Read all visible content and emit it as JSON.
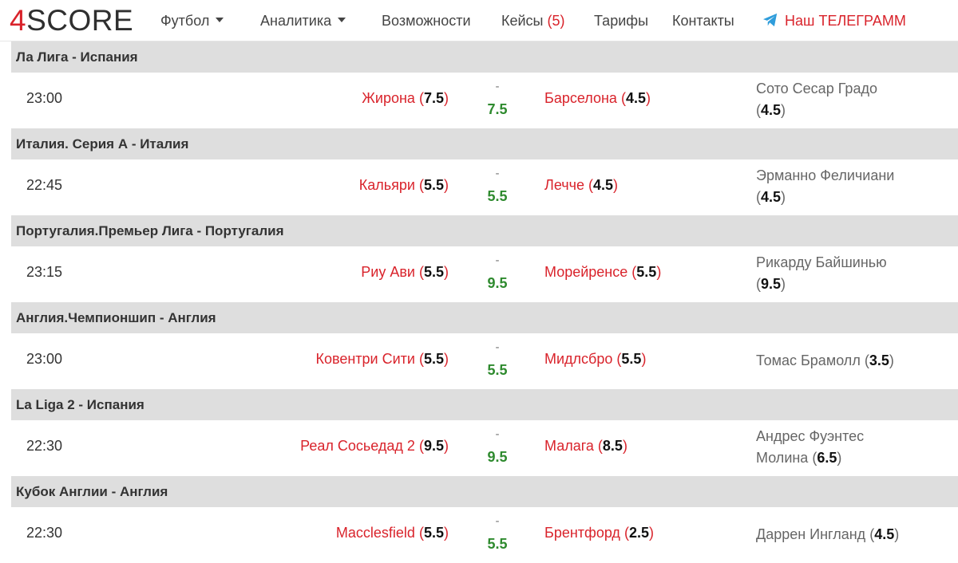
{
  "nav": {
    "logo_num": "4",
    "logo_text": "SCORE",
    "football": "Футбол",
    "analytics": "Аналитика",
    "features": "Возможности",
    "cases_label": "Кейсы",
    "cases_count": "(5)",
    "tariffs": "Тарифы",
    "contacts": "Контакты",
    "telegram": "Наш ТЕЛЕГРАММ"
  },
  "colors": {
    "accent_red": "#d9232b",
    "total_green": "#2e8a2e",
    "header_gray": "#dedede"
  },
  "icons": {
    "telegram": "telegram-plane-icon",
    "dropdown": "caret-down-icon"
  },
  "leagues": [
    {
      "title": "Ла Лига - Испания",
      "time": "23:00",
      "home": "Жирона",
      "home_rating": "7.5",
      "dash": "-",
      "total": "7.5",
      "away": "Барселона",
      "away_rating": "4.5",
      "referee_line1": "Сото Сесар Градо",
      "referee_line2": "",
      "referee_rating": "4.5"
    },
    {
      "title": "Италия. Серия А - Италия",
      "time": "22:45",
      "home": "Кальяри",
      "home_rating": "5.5",
      "dash": "-",
      "total": "5.5",
      "away": "Лечче",
      "away_rating": "4.5",
      "referee_line1": "Эрманно Феличиани",
      "referee_line2": "",
      "referee_rating": "4.5"
    },
    {
      "title": "Португалия.Премьер Лига - Португалия",
      "time": "23:15",
      "home": "Риу Ави",
      "home_rating": "5.5",
      "dash": "-",
      "total": "9.5",
      "away": "Морейренсе",
      "away_rating": "5.5",
      "referee_line1": "Рикарду Байшинью",
      "referee_line2": "",
      "referee_rating": "9.5"
    },
    {
      "title": "Англия.Чемпионшип - Англия",
      "time": "23:00",
      "home": "Ковентри Сити",
      "home_rating": "5.5",
      "dash": "-",
      "total": "5.5",
      "away": "Мидлсбро",
      "away_rating": "5.5",
      "referee_line1": "Томас Брамолл",
      "referee_rating": "3.5"
    },
    {
      "title": "La Liga 2 - Испания",
      "time": "22:30",
      "home": "Реал Сосьедад 2",
      "home_rating": "9.5",
      "dash": "-",
      "total": "9.5",
      "away": "Малага",
      "away_rating": "8.5",
      "referee_line1": "Андрес Фуэнтес",
      "referee_line2": "Молина",
      "referee_rating": "6.5"
    },
    {
      "title": "Кубок Англии - Англия",
      "time": "22:30",
      "home": "Macclesfield",
      "home_rating": "5.5",
      "dash": "-",
      "total": "5.5",
      "away": "Брентфорд",
      "away_rating": "2.5",
      "referee_line1": "Даррен Ингланд",
      "referee_rating": "4.5"
    }
  ]
}
